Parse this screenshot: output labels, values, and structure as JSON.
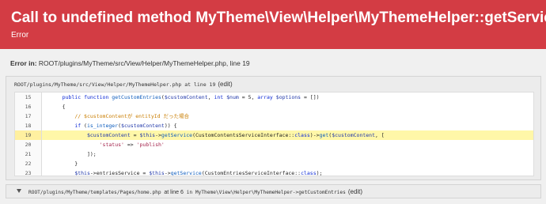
{
  "header": {
    "title": "Call to undefined method MyTheme\\View\\Helper\\MyThemeHelper::getService()",
    "subtitle": "Error",
    "bg_color": "#d33c44"
  },
  "error_in": {
    "label": "Error in:",
    "path": "ROOT/plugins/MyTheme/src/View/Helper/MyThemeHelper.php, line 19"
  },
  "frame": {
    "path": "ROOT/plugins/MyTheme/src/View/Helper/MyThemeHelper.php at line 19",
    "edit_label": "(edit)",
    "highlight_line": "19",
    "lines": [
      {
        "num": "15",
        "code": "    public function getCustomEntries($customContent, int $num = 5, array $options = [])"
      },
      {
        "num": "16",
        "code": "    {"
      },
      {
        "num": "17",
        "code": "        // $customContentが entityId だった場合"
      },
      {
        "num": "18",
        "code": "        if (is_integer($customContent)) {"
      },
      {
        "num": "19",
        "code": "            $customContent = $this->getService(CustomContentsServiceInterface::class)->get($customContent, ["
      },
      {
        "num": "20",
        "code": "                'status' => 'publish'"
      },
      {
        "num": "21",
        "code": "            ]);"
      },
      {
        "num": "22",
        "code": "        }"
      },
      {
        "num": "23",
        "code": "        $this->entriesService = $this->getService(CustomEntriesServiceInterface::class);"
      }
    ]
  },
  "trace": {
    "path": "ROOT/plugins/MyTheme/templates/Pages/home.php",
    "at_line": "at line 6",
    "in_label": "in",
    "method": "MyTheme\\View\\Helper\\MyThemeHelper->getCustomEntries",
    "edit_label": "(edit)"
  }
}
